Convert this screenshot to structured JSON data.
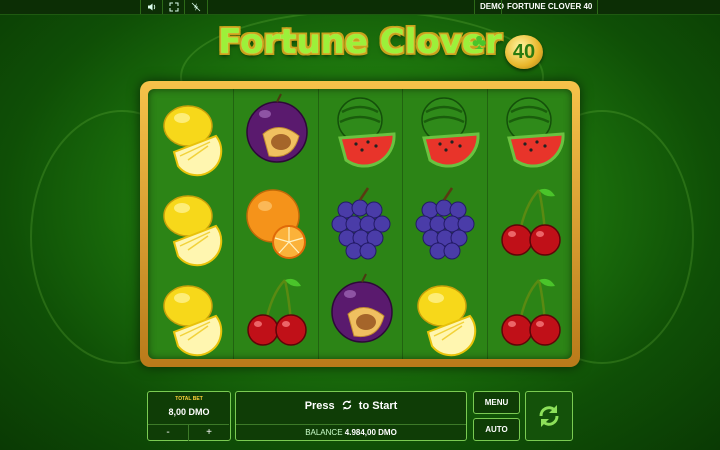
{
  "topbar": {
    "sound_icon": "speaker-icon",
    "fullscreen_icon": "expand-icon",
    "lightning_icon": "lightning-off-icon",
    "mode_label": "DEMO",
    "game_label": "FORTUNE CLOVER 40"
  },
  "logo": {
    "title": "Fortune Clover",
    "number": "40"
  },
  "reels": [
    [
      "lemon",
      "lemon",
      "lemon"
    ],
    [
      "plum",
      "orange",
      "cherry"
    ],
    [
      "watermelon",
      "grapes",
      "plum"
    ],
    [
      "watermelon",
      "grapes",
      "lemon"
    ],
    [
      "watermelon",
      "cherry",
      "cherry"
    ]
  ],
  "bet": {
    "title": "TOTAL BET",
    "value": "8,00 DMO",
    "minus_label": "-",
    "plus_label": "+"
  },
  "spin_info": {
    "press_label": "Press",
    "to_start_label": "to Start",
    "balance_label": "BALANCE",
    "balance_value": "4.984,00 DMO"
  },
  "buttons": {
    "menu_label": "MENU",
    "auto_label": "AUTO"
  },
  "colors": {
    "frame_gold": "#e9a93a",
    "reel_green": "#2c8416",
    "accent_green": "#7acb52"
  }
}
